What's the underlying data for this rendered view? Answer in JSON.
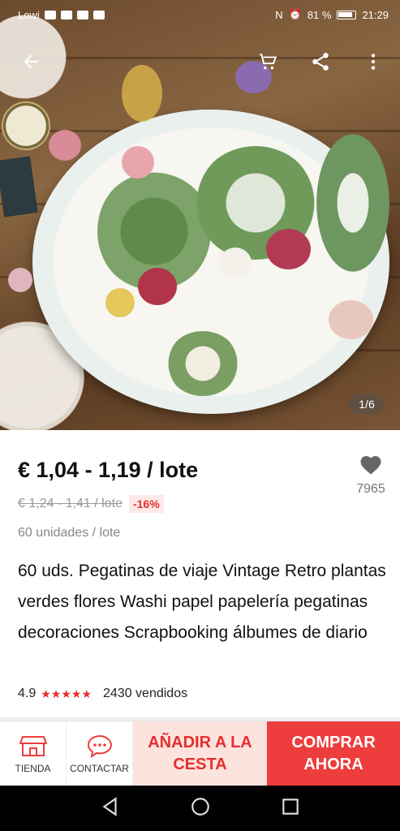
{
  "status_bar": {
    "carrier": "Lowi",
    "battery": "81 %",
    "time": "21:29"
  },
  "hero": {
    "page_counter": "1/6",
    "icons": [
      "back-arrow-icon",
      "cart-icon",
      "share-icon",
      "more-vert-icon"
    ]
  },
  "product": {
    "price": "€ 1,04 - 1,19 / lote",
    "old_price": "€ 1,24 - 1,41 / lote",
    "discount": "-16%",
    "unit": "60 unidades / lote",
    "title": "60 uds. Pegatinas de viaje Vintage Retro plantas verdes flores Washi papel papelería pegatinas decoraciones Scrapbooking álbumes de diario",
    "rating": "4.9",
    "stars": "★★★★★",
    "sold": "2430 vendidos",
    "wishlist_count": "7965"
  },
  "actions": {
    "store_label": "TIENDA",
    "contact_label": "CONTACTAR",
    "add_to_cart_label": "AÑADIR A LA CESTA",
    "buy_now_label": "COMPRAR AHORA"
  },
  "colors": {
    "accent": "#ee3d3d",
    "accent_light": "#fde3dd",
    "star": "#e62e2e"
  }
}
